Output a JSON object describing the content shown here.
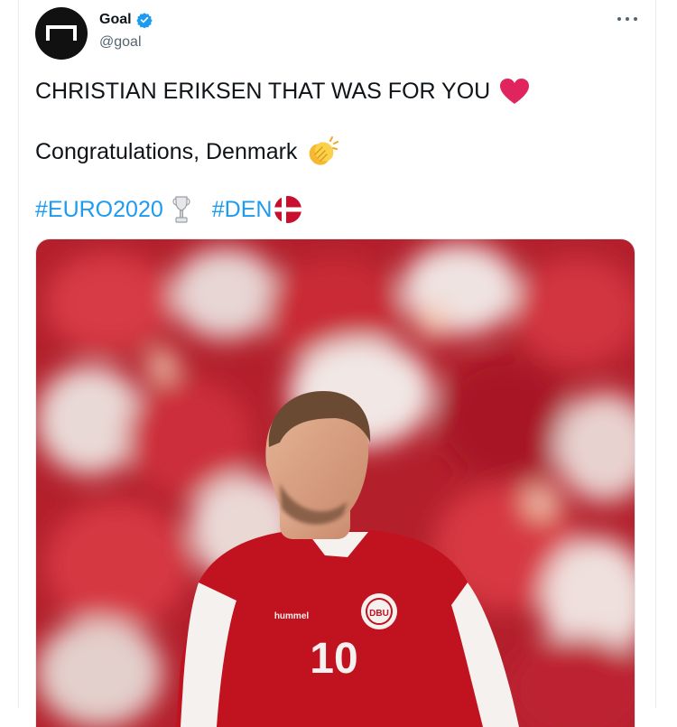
{
  "tweet": {
    "author_name": "Goal",
    "author_handle": "@goal",
    "line1": "CHRISTIAN ERIKSEN THAT WAS FOR YOU",
    "line2": "Congratulations, Denmark",
    "hashtag1": "#EURO2020",
    "hashtag2": "#DEN",
    "emoji_line1": "heart-emoji",
    "emoji_line2": "clapping-hands-emoji",
    "emoji_hashtag1": "trophy-emoji",
    "emoji_hashtag2": "denmark-flag-emoji"
  },
  "photo": {
    "jersey_number": "10",
    "crest_text": "DBU",
    "sponsor": "hummel"
  },
  "colors": {
    "link": "#1d9bf0",
    "verified": "#1d9bf0",
    "heart": "#e0245e",
    "denmark_red": "#c8102e"
  }
}
